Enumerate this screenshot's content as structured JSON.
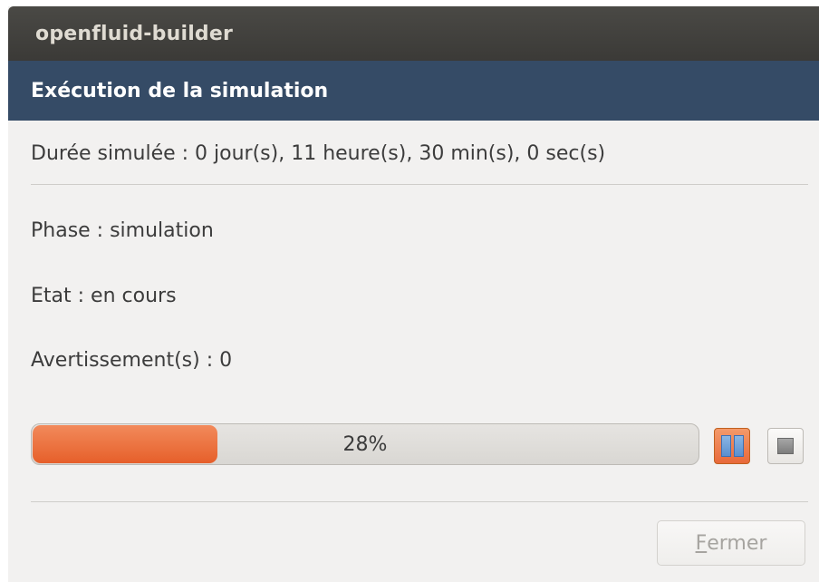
{
  "window": {
    "title": "openfluid-builder"
  },
  "header": {
    "title": "Exécution de la simulation"
  },
  "info": {
    "duration_label": "Durée simulée :",
    "duration_value": "0 jour(s), 11 heure(s), 30 min(s), 0 sec(s)",
    "phase_label": "Phase :",
    "phase_value": "simulation",
    "state_label": "Etat :",
    "state_value": "en cours",
    "warnings_label": "Avertissement(s) :",
    "warnings_value": "0"
  },
  "progress": {
    "percent": 28,
    "text": "28%"
  },
  "controls": {
    "pause_icon": "pause-icon",
    "stop_icon": "stop-icon"
  },
  "footer": {
    "close_mnemonic": "F",
    "close_rest": "ermer"
  },
  "colors": {
    "titlebar": "#3b3a37",
    "header": "#354b66",
    "progress_fill": "#ec6f3c",
    "pause_button": "#ee7d4c",
    "pause_glyph": "#5a8fcf"
  }
}
